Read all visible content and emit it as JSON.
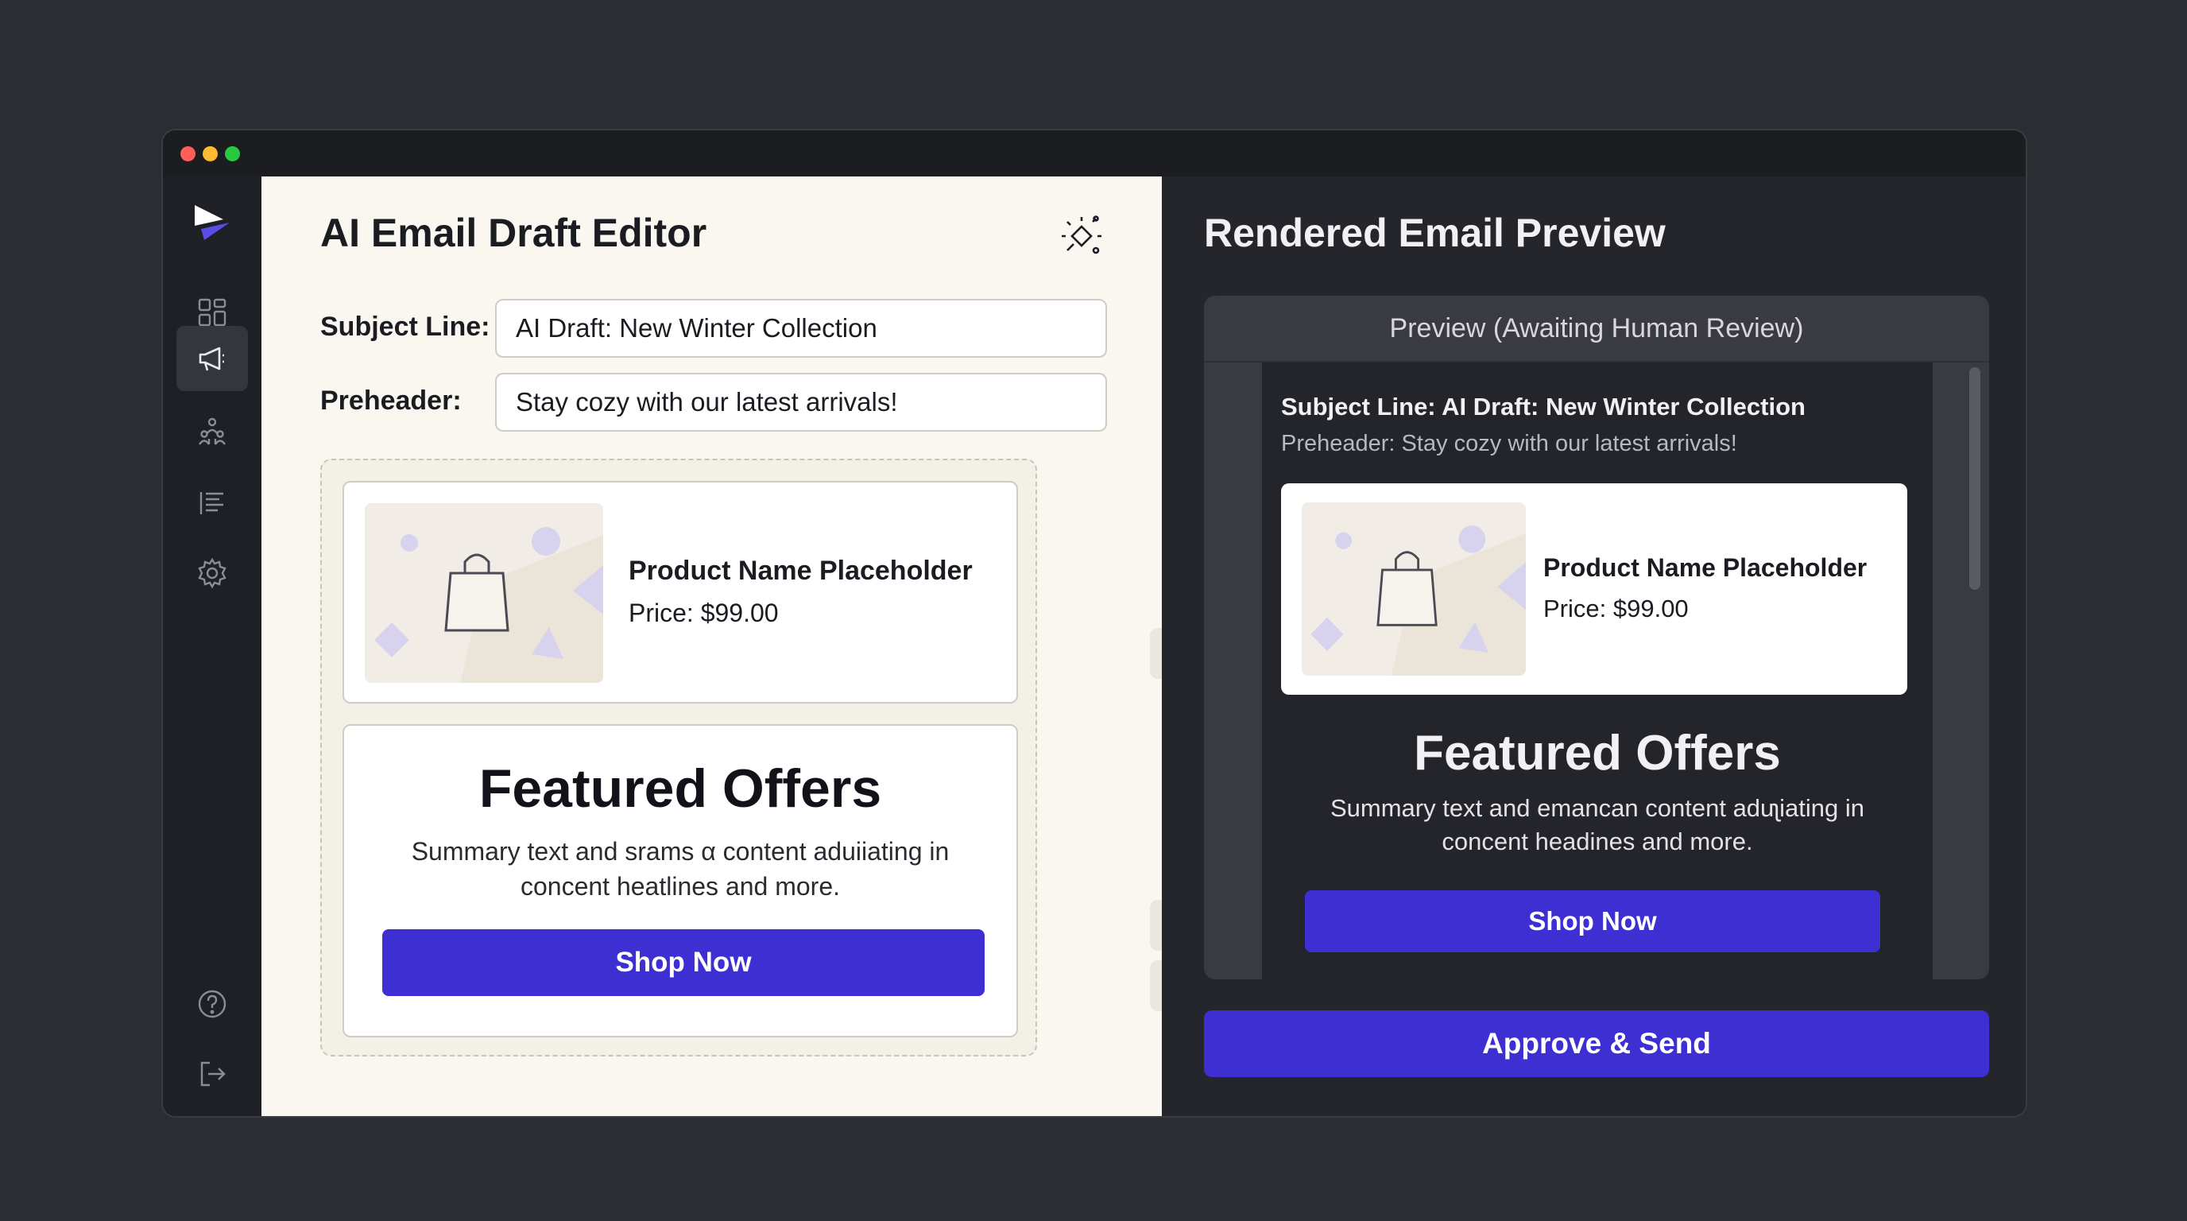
{
  "window": {
    "controls": {
      "close_color": "#ff5f57",
      "minimize_color": "#febc2e",
      "maximize_color": "#28c840"
    }
  },
  "sidebar": {
    "logo": "app-logo",
    "items": [
      {
        "icon": "dashboard-grid-icon",
        "active": false
      },
      {
        "icon": "megaphone-icon",
        "active": true
      },
      {
        "icon": "audience-people-icon",
        "active": false
      },
      {
        "icon": "list-lines-icon",
        "active": false
      },
      {
        "icon": "settings-gear-icon",
        "active": false
      }
    ],
    "bottom_items": [
      {
        "icon": "help-icon"
      },
      {
        "icon": "logout-icon"
      }
    ]
  },
  "editor": {
    "title": "AI Email Draft Editor",
    "ai_icon": "ai-sparkle-icon",
    "subject_label": "Subject Line:",
    "subject_value": "AI Draft: New Winter Collection",
    "preheader_label": "Preheader:",
    "preheader_value": "Stay cozy with our latest arrivals!",
    "product_block": {
      "name": "Product Name Placeholder",
      "price": "Price: $99.00",
      "image_icon": "shopping-bag-icon"
    },
    "featured_block": {
      "title": "Featured Offers",
      "summary_line1": "Summary text and srams α content aduiiating in",
      "summary_line2": "concent heatlines and more.",
      "button": "Shop Now"
    },
    "tools": [
      "add-icon",
      "add-icon",
      "align-icon",
      "block-layout-icon",
      "code-icon",
      "add-icon",
      "align-icon"
    ]
  },
  "preview": {
    "title": "Rendered Email Preview",
    "header": "Preview (Awaiting Human Review)",
    "subject_line": "Subject Line: AI Draft: New Winter Collection",
    "preheader_line": "Preheader: Stay cozy with our latest arrivals!",
    "product_block": {
      "name": "Product Name Placeholder",
      "price": "Price: $99.00",
      "image_icon": "shopping-bag-icon"
    },
    "featured_block": {
      "title": "Featured Offers",
      "summary_line1": "Summary text and emancan content aduʅiating in",
      "summary_line2": "concent headines and more.",
      "button": "Shop Now"
    },
    "approve_button": "Approve & Send"
  },
  "colors": {
    "accent": "#3d2fd1",
    "editor_bg": "#faf7f0",
    "preview_bg": "#25262c",
    "page_bg": "#2b2d33"
  }
}
